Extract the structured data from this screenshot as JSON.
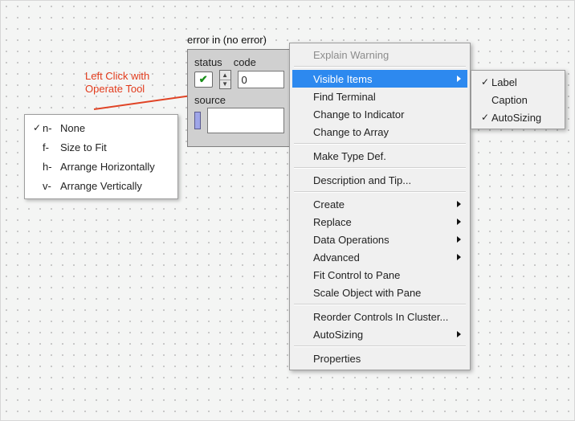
{
  "callout": {
    "text": "Left Click with\nOperate Tool"
  },
  "autosize_menu": {
    "items": [
      {
        "checked": true,
        "key": "n-",
        "label": "None"
      },
      {
        "checked": false,
        "key": "f-",
        "label": "Size to Fit"
      },
      {
        "checked": false,
        "key": "h-",
        "label": "Arrange Horizontally"
      },
      {
        "checked": false,
        "key": "v-",
        "label": "Arrange Vertically"
      }
    ]
  },
  "cluster": {
    "caption": "error in (no error)",
    "status_label": "status",
    "code_label": "code",
    "code_value": "0",
    "status_glyph": "✔",
    "source_label": "source"
  },
  "context_menu": {
    "items": [
      {
        "label": "Explain Warning",
        "disabled": true
      },
      "---",
      {
        "label": "Visible Items",
        "submenu": true,
        "highlight": true
      },
      {
        "label": "Find Terminal"
      },
      {
        "label": "Change to Indicator"
      },
      {
        "label": "Change to Array"
      },
      "---",
      {
        "label": "Make Type Def."
      },
      "---",
      {
        "label": "Description and Tip..."
      },
      "---",
      {
        "label": "Create",
        "submenu": true
      },
      {
        "label": "Replace",
        "submenu": true
      },
      {
        "label": "Data Operations",
        "submenu": true
      },
      {
        "label": "Advanced",
        "submenu": true
      },
      {
        "label": "Fit Control to Pane"
      },
      {
        "label": "Scale Object with Pane"
      },
      "---",
      {
        "label": "Reorder Controls In Cluster..."
      },
      {
        "label": "AutoSizing",
        "submenu": true
      },
      "---",
      {
        "label": "Properties"
      }
    ]
  },
  "visible_items_submenu": {
    "items": [
      {
        "checked": true,
        "label": "Label"
      },
      {
        "checked": false,
        "label": "Caption"
      },
      {
        "checked": true,
        "label": "AutoSizing"
      }
    ]
  }
}
